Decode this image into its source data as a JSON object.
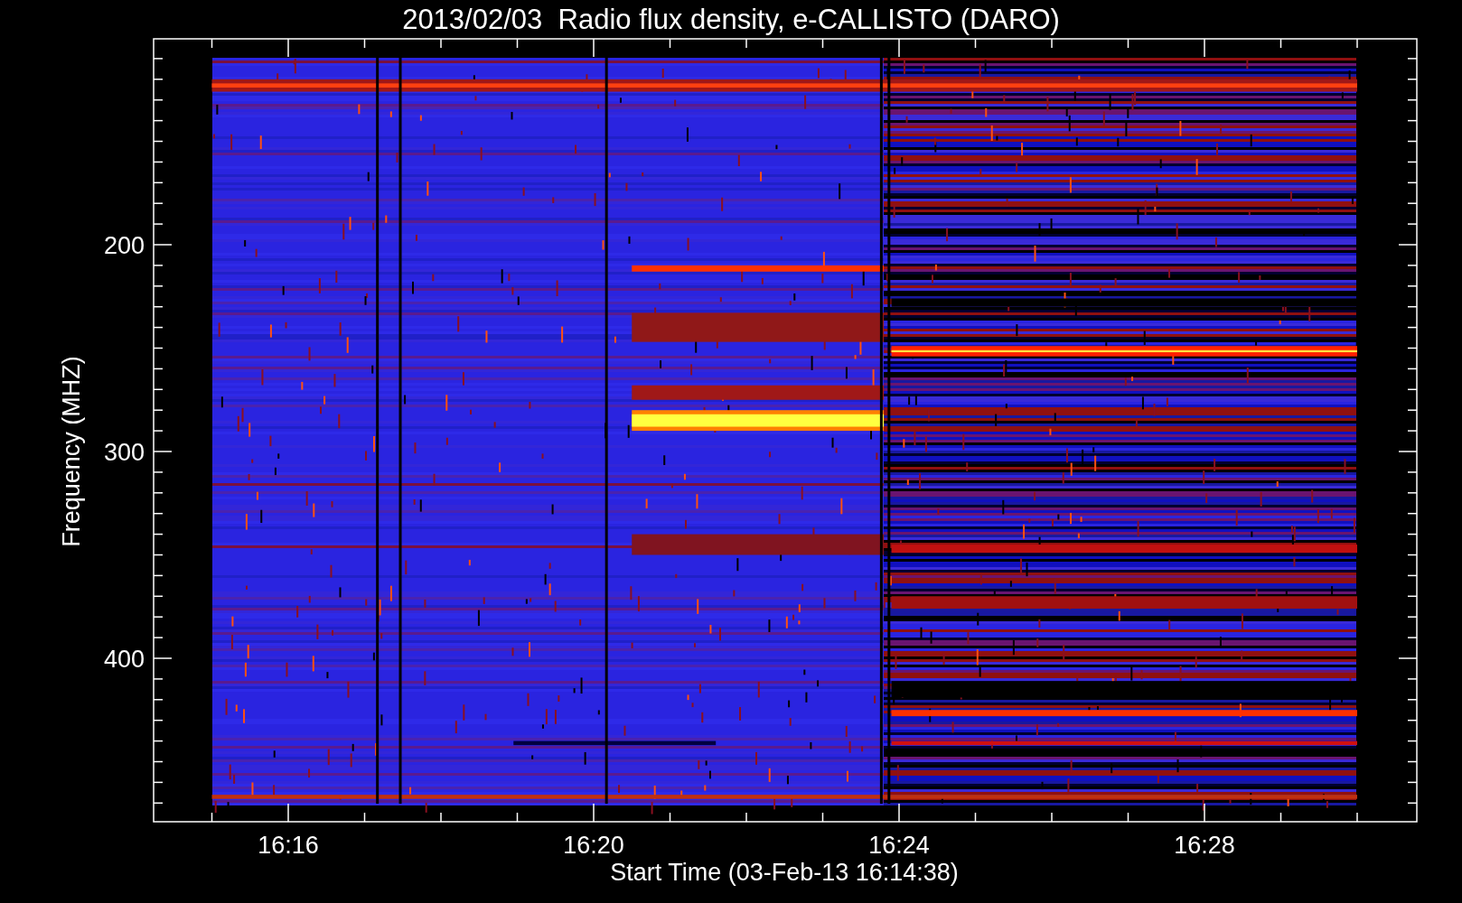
{
  "title": "2013/02/03  Radio flux density, e-CALLISTO (DARO)",
  "y_axis": {
    "label": "Frequency (MHZ)",
    "ticks": [
      "200",
      "300",
      "400"
    ]
  },
  "x_axis": {
    "label": "Start Time (03-Feb-13 16:14:38)",
    "ticks": [
      "16:16",
      "16:20",
      "16:24",
      "16:28"
    ]
  }
}
